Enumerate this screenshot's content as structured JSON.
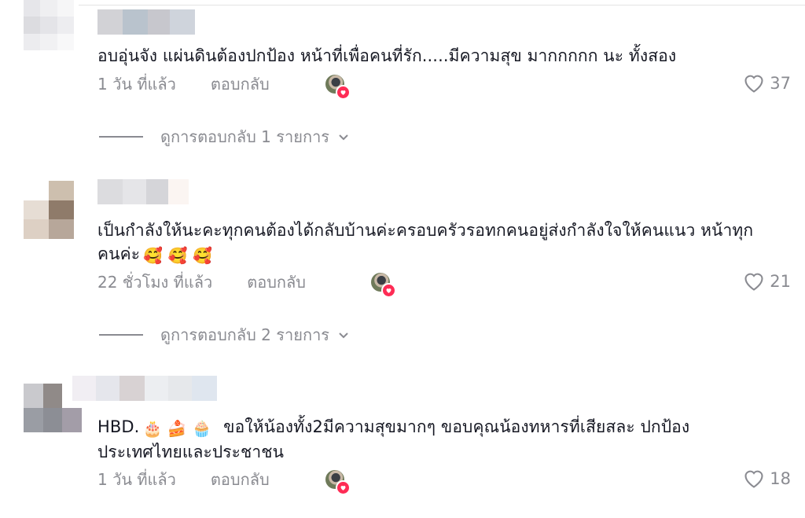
{
  "comments": [
    {
      "text": "อบอุ่นจัง แผ่นดินต้องปกป้อง หน้าที่เพื่อคนที่รัก.....มีความสุข มากกกกก นะ ทั้งสอง",
      "time": "1 วัน ที่แล้ว",
      "reply_label": "ตอบกลับ",
      "likes": "37",
      "view_replies": "ดูการตอบกลับ 1 รายการ"
    },
    {
      "text": "เป็นกำลังให้นะคะทุกคนต้องได้กลับบ้านค่ะครอบครัวรอทกคนอยู่ส่งกำลังใจให้คนแนว หน้าทุกคนค่ะ",
      "emojis": "🥰 🥰 🥰",
      "time": "22 ชั่วโมง ที่แล้ว",
      "reply_label": "ตอบกลับ",
      "likes": "21",
      "view_replies": "ดูการตอบกลับ 2 รายการ"
    },
    {
      "text_prefix": "HBD.",
      "emojis": "🎂 🍰 🧁",
      "text": "ขอให้น้องทั้ง2มีความสุขมากๆ ขอบคุณน้องทหารที่เสียสละ ปกป้อง ประเทศไทยและประชาชน",
      "time": "1 วัน ที่แล้ว",
      "reply_label": "ตอบกลับ",
      "likes": "18"
    }
  ],
  "colors": {
    "text": "#161823",
    "secondary": "#8a8b91",
    "badge": "#fe2c55"
  },
  "icons": {
    "like": "heart-outline-icon",
    "expand": "chevron-down-icon",
    "creator_badge": "heart-badge-icon"
  }
}
